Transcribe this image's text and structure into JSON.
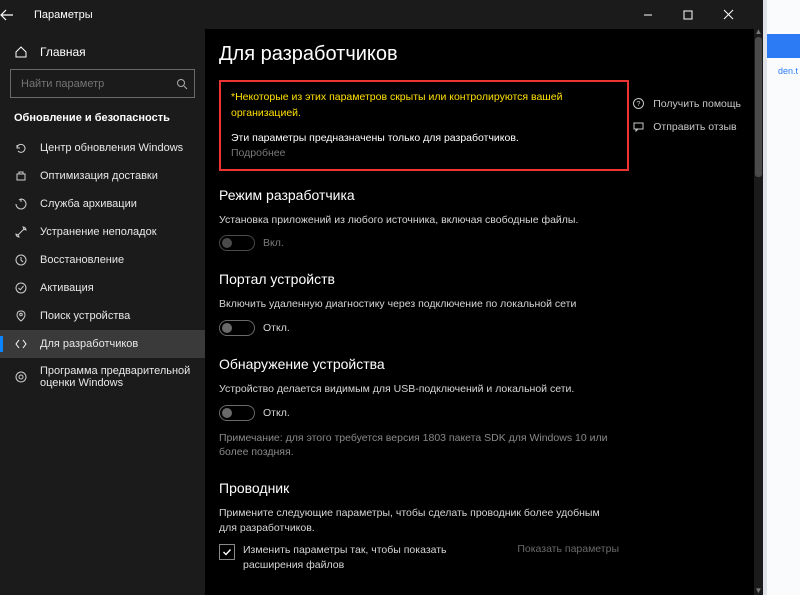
{
  "window_title": "Параметры",
  "right_strip": {
    "link": "den.t"
  },
  "home": {
    "label": "Главная"
  },
  "search": {
    "placeholder": "Найти параметр"
  },
  "section_title": "Обновление и безопасность",
  "nav": [
    {
      "label": "Центр обновления Windows"
    },
    {
      "label": "Оптимизация доставки"
    },
    {
      "label": "Служба архивации"
    },
    {
      "label": "Устранение неполадок"
    },
    {
      "label": "Восстановление"
    },
    {
      "label": "Активация"
    },
    {
      "label": "Поиск устройства"
    },
    {
      "label": "Для разработчиков",
      "selected": true
    },
    {
      "label": "Программа предварительной оценки Windows"
    }
  ],
  "page_title": "Для разработчиков",
  "notice": {
    "warning": "*Некоторые из этих параметров скрыты или контролируются вашей организацией.",
    "description": "Эти параметры предназначены только для разработчиков.",
    "more": "Подробнее"
  },
  "aside": {
    "help": "Получить помощь",
    "feedback": "Отправить отзыв"
  },
  "dev_mode": {
    "heading": "Режим разработчика",
    "desc": "Установка приложений из любого источника, включая свободные файлы.",
    "toggle_label": "Вкл."
  },
  "device_portal": {
    "heading": "Портал устройств",
    "desc": "Включить удаленную диагностику через подключение по локальной сети",
    "toggle_label": "Откл."
  },
  "device_discovery": {
    "heading": "Обнаружение устройства",
    "desc": "Устройство делается видимым для USB-подключений и локальной сети.",
    "toggle_label": "Откл.",
    "note": "Примечание: для этого требуется версия 1803 пакета SDK для Windows 10 или более поздняя."
  },
  "explorer": {
    "heading": "Проводник",
    "desc": "Примените следующие параметры, чтобы сделать проводник более удобным для разработчиков.",
    "check1": "Изменить параметры так, чтобы показать расширения файлов",
    "show_link": "Показать параметры"
  }
}
